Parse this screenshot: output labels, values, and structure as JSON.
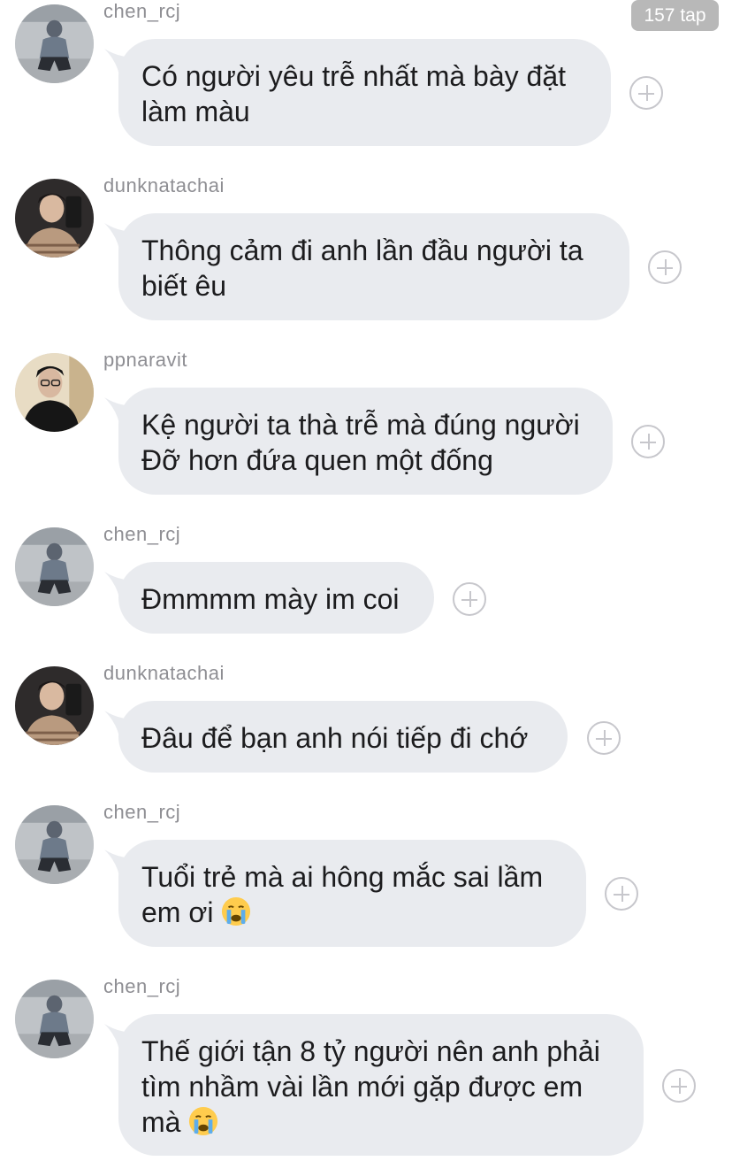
{
  "tap_count": "157 tap",
  "colors": {
    "bubble": "#e9ebef",
    "username": "#8e8e93",
    "text": "#1c1c1e",
    "badge": "#b8b8b8"
  },
  "messages": [
    {
      "user": "chen_rcj",
      "avatar": "avatar-chen",
      "lines": [
        "Có người yêu trễ nhất mà bày đặt",
        "làm màu"
      ]
    },
    {
      "user": "dunknatachai",
      "avatar": "avatar-dunk",
      "lines": [
        "Thông cảm đi anh lần đầu người ta",
        "biết êu"
      ]
    },
    {
      "user": "ppnaravit",
      "avatar": "avatar-pp",
      "lines": [
        "Kệ người ta thà trễ mà đúng người",
        "Đỡ hơn đứa quen một đống"
      ]
    },
    {
      "user": "chen_rcj",
      "avatar": "avatar-chen",
      "lines": [
        "Đmmmm mày im coi"
      ]
    },
    {
      "user": "dunknatachai",
      "avatar": "avatar-dunk",
      "lines": [
        "Đâu để bạn anh nói tiếp đi chớ"
      ]
    },
    {
      "user": "chen_rcj",
      "avatar": "avatar-chen",
      "lines": [
        "Tuổi trẻ mà ai hông mắc sai lầm",
        "em ơi"
      ],
      "emoji": "crying-face"
    },
    {
      "user": "chen_rcj",
      "avatar": "avatar-chen",
      "lines": [
        "Thế giới tận 8 tỷ người nên anh phải",
        "tìm nhầm vài lần mới gặp được em",
        "mà"
      ],
      "emoji": "crying-face"
    }
  ]
}
